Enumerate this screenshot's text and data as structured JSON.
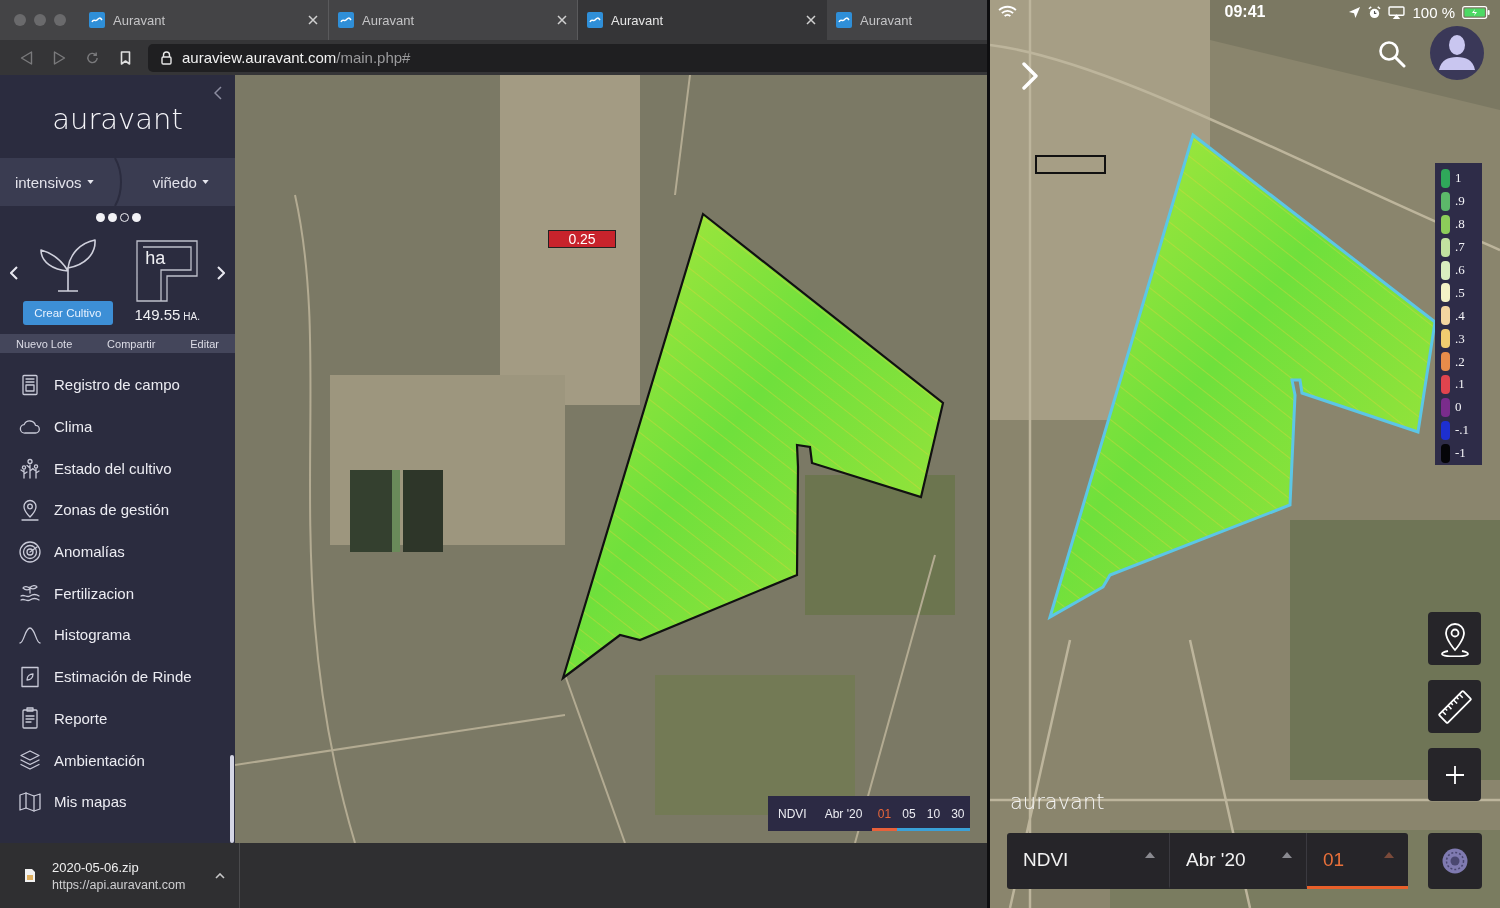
{
  "browser": {
    "tabs": [
      {
        "title": "Auravant",
        "selected": false,
        "close_button": true
      },
      {
        "title": "Auravant",
        "selected": false,
        "close_button": true
      },
      {
        "title": "Auravant",
        "selected": true,
        "close_button": true
      },
      {
        "title": "Auravant",
        "selected": false,
        "close_button": false
      }
    ],
    "address": {
      "host": "auraview.auravant.com",
      "path": "/main.php#"
    }
  },
  "sidebar": {
    "logo": "auravant",
    "categories": [
      "intensivos",
      "viñedo"
    ],
    "page_dots": [
      {
        "selected": false
      },
      {
        "selected": false
      },
      {
        "selected": true
      },
      {
        "selected": false
      }
    ],
    "carousel": {
      "button": "Crear Cultivo",
      "area_icon_label": "ha",
      "area_value": "149.55",
      "area_unit": "HA."
    },
    "actions": [
      "Nuevo Lote",
      "Compartir",
      "Editar"
    ],
    "menu": [
      "Registro de campo",
      "Clima",
      "Estado del cultivo",
      "Zonas de gestión",
      "Anomalías",
      "Fertilizacion",
      "Histograma",
      "Estimación de Rinde",
      "Reporte",
      "Ambientación",
      "Mis mapas"
    ]
  },
  "map": {
    "value_label": "0.25",
    "legend": {
      "index": "NDVI",
      "month": "Abr '20",
      "days": [
        {
          "label": "01",
          "selected": true
        },
        {
          "label": "05",
          "selected": false
        },
        {
          "label": "10",
          "selected": false
        },
        {
          "label": "30",
          "selected": false
        }
      ]
    }
  },
  "download_bar": {
    "file_name": "2020-05-06.zip",
    "source": "https://api.auravant.com"
  },
  "tablet": {
    "status_bar": {
      "time": "09:41",
      "battery": "100 %"
    },
    "ndvi_scale": [
      {
        "label": "1",
        "color": "#2fa85a"
      },
      {
        "label": ".9",
        "color": "#5cb86a"
      },
      {
        "label": ".8",
        "color": "#8ccc5a"
      },
      {
        "label": ".7",
        "color": "#c2e2a0"
      },
      {
        "label": ".6",
        "color": "#d9eec0"
      },
      {
        "label": ".5",
        "color": "#f4f2c6"
      },
      {
        "label": ".4",
        "color": "#f3d5a0"
      },
      {
        "label": ".3",
        "color": "#f0cc70"
      },
      {
        "label": ".2",
        "color": "#e88c4a"
      },
      {
        "label": ".1",
        "color": "#e0444e"
      },
      {
        "label": "0",
        "color": "#7a2c8c"
      },
      {
        "label": "-.1",
        "color": "#1d2fd0"
      },
      {
        "label": "-1",
        "color": "#050508"
      }
    ],
    "logo": "auravant",
    "selectors": [
      {
        "label": "NDVI",
        "selected": false
      },
      {
        "label": "Abr '20",
        "selected": false
      },
      {
        "label": "01",
        "selected": true
      }
    ]
  }
}
